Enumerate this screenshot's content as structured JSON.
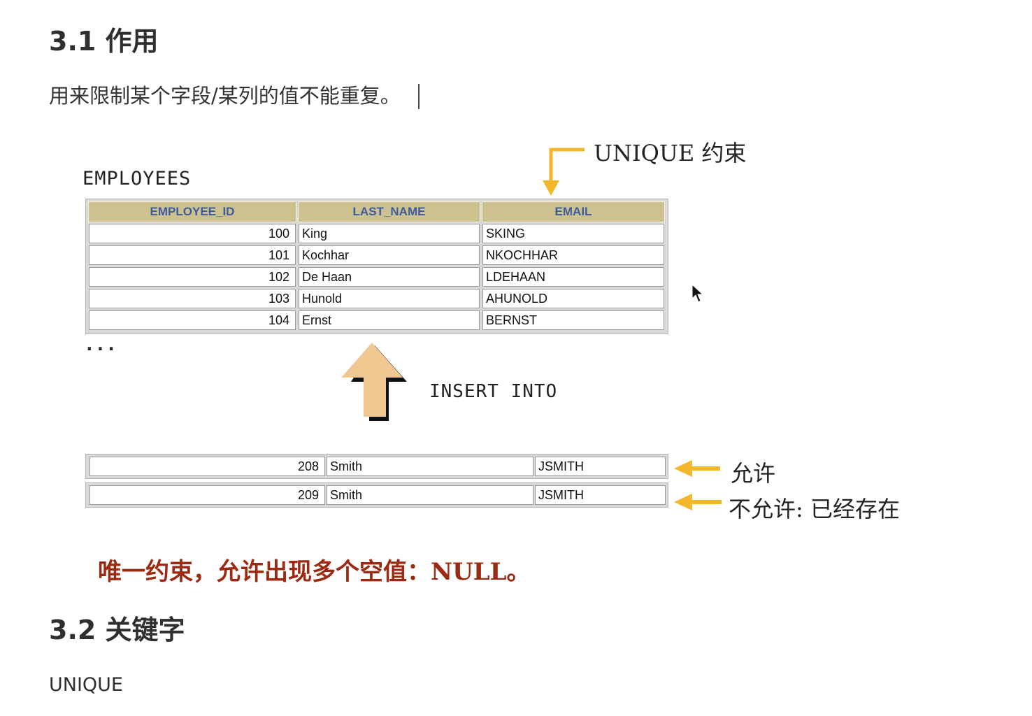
{
  "section1": {
    "title": "3.1 作用",
    "text": "用来限制某个字段/某列的值不能重复。"
  },
  "diagram": {
    "table_name": "EMPLOYEES",
    "unique_label": "UNIQUE 约束",
    "ellipsis": "...",
    "insert_label": "INSERT INTO",
    "columns": [
      "EMPLOYEE_ID",
      "LAST_NAME",
      "EMAIL"
    ],
    "rows": [
      [
        "100",
        "King",
        "SKING"
      ],
      [
        "101",
        "Kochhar",
        "NKOCHHAR"
      ],
      [
        "102",
        "De Haan",
        "LDEHAAN"
      ],
      [
        "103",
        "Hunold",
        "AHUNOLD"
      ],
      [
        "104",
        "Ernst",
        "BERNST"
      ]
    ],
    "new_rows": [
      {
        "id": "208",
        "last_name": "Smith",
        "email": "JSMITH",
        "label": "允许"
      },
      {
        "id": "209",
        "last_name": "Smith",
        "email": "JSMITH",
        "label": "不允许: 已经存在"
      }
    ],
    "note": "唯一约束，允许出现多个空值：NULL。",
    "arrow_color": "#f2b72a",
    "insert_arrow_color": "#f0c891"
  },
  "section2": {
    "title": "3.2 关键字",
    "text": "UNIQUE"
  }
}
